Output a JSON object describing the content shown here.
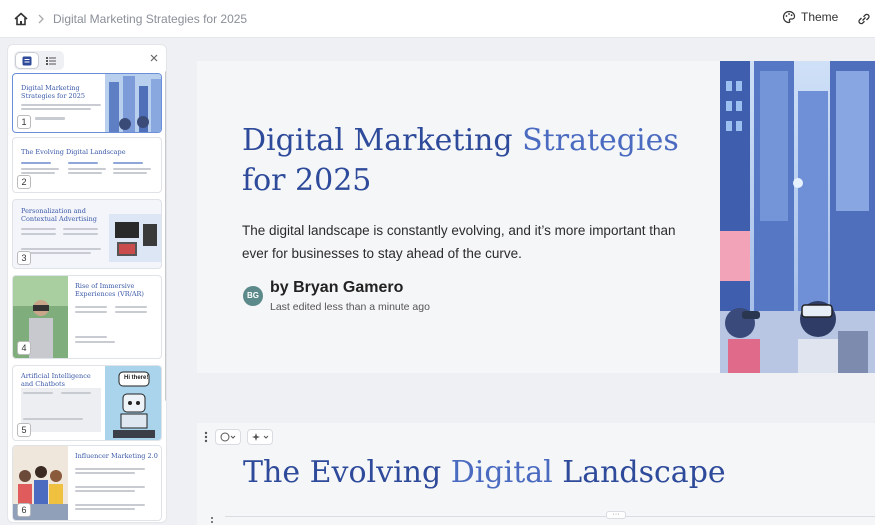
{
  "breadcrumb": {
    "title": "Digital Marketing Strategies for 2025"
  },
  "toolbar": {
    "theme_label": "Theme"
  },
  "sidebar": {
    "thumbnails": [
      {
        "number": "1",
        "title": "Digital Marketing Strategies for 2025"
      },
      {
        "number": "2",
        "title": "The Evolving Digital Landscape"
      },
      {
        "number": "3",
        "title": "Personalization and Contextual Advertising"
      },
      {
        "number": "4",
        "title": "Rise of Immersive Experiences (VR/AR)"
      },
      {
        "number": "5",
        "title": "Artificial Intelligence and Chatbots",
        "bubble": "Hi there!"
      },
      {
        "number": "6",
        "title": "Influencer Marketing 2.0"
      }
    ]
  },
  "slide1": {
    "title_part1": "Digital Marketing",
    "title_part2": "Strategies",
    "title_part3": "for 2025",
    "description": "The digital landscape is constantly evolving, and it’s more important than ever for businesses to stay ahead of the curve.",
    "author_initials": "BG",
    "author": "by Bryan Gamero",
    "edited": "Last edited less than a minute ago"
  },
  "slide2": {
    "title_part1": "The Evolving",
    "title_part2": "Digital",
    "title_part3": "Landscape"
  },
  "more_label": "···",
  "colors": {
    "accent": "#2e4a9a",
    "accent_light": "#4a6bc0",
    "selected_border": "#6a8fd8"
  }
}
